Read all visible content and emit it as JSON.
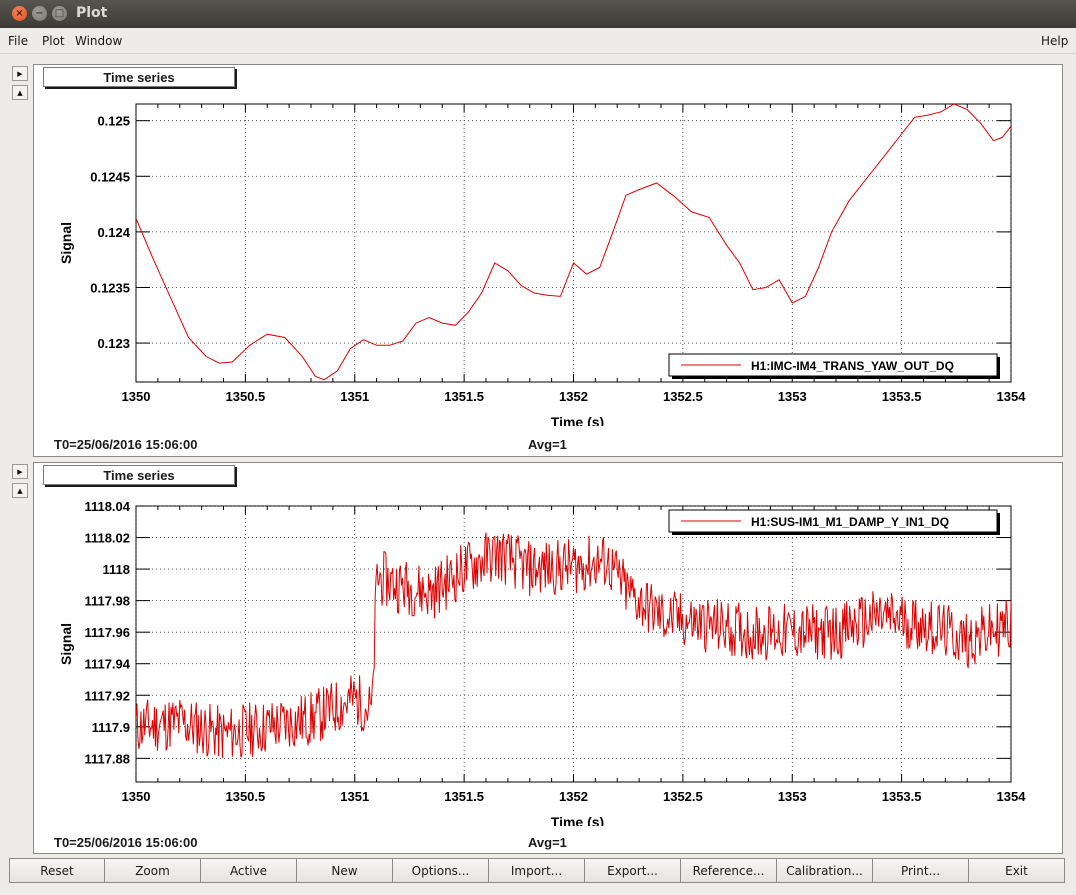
{
  "window": {
    "title": "Plot"
  },
  "menu": {
    "file": "File",
    "plot": "Plot",
    "window": "Window",
    "help": "Help"
  },
  "panels": [
    {
      "tab_label": "Time series",
      "t0": "T0=25/06/2016 15:06:00",
      "avg": "Avg=1",
      "chart_data": {
        "type": "line",
        "xlabel": "Time (s)",
        "ylabel": "Signal",
        "xlim": [
          1350,
          1354
        ],
        "ylim": [
          1.2265,
          1.2515
        ],
        "ylim_scale": 0.1,
        "x_ticks": [
          "1350",
          "1350.5",
          "1351",
          "1351.5",
          "1352",
          "1352.5",
          "1353",
          "1353.5",
          "1354"
        ],
        "y_ticks": [
          {
            "value": 0.123,
            "label": "0.123"
          },
          {
            "value": 0.1235,
            "label": "0.1235"
          },
          {
            "value": 0.124,
            "label": "0.124"
          },
          {
            "value": 0.1245,
            "label": "0.1245"
          },
          {
            "value": 0.125,
            "label": "0.125"
          }
        ],
        "grid": true,
        "legend_position": "bottom-right",
        "series": [
          {
            "name": "H1:IMC-IM4_TRANS_YAW_OUT_DQ",
            "color": "#e00000",
            "x": [
              1350,
              1350.08,
              1350.16,
              1350.24,
              1350.32,
              1350.38,
              1350.44,
              1350.52,
              1350.6,
              1350.68,
              1350.76,
              1350.82,
              1350.86,
              1350.92,
              1350.98,
              1351.04,
              1351.1,
              1351.16,
              1351.22,
              1351.28,
              1351.34,
              1351.4,
              1351.46,
              1351.52,
              1351.58,
              1351.64,
              1351.7,
              1351.76,
              1351.82,
              1351.88,
              1351.94,
              1352,
              1352.06,
              1352.12,
              1352.18,
              1352.24,
              1352.3,
              1352.38,
              1352.46,
              1352.54,
              1352.62,
              1352.7,
              1352.76,
              1352.82,
              1352.88,
              1352.94,
              1353,
              1353.06,
              1353.12,
              1353.18,
              1353.26,
              1353.34,
              1353.42,
              1353.5,
              1353.56,
              1353.62,
              1353.68,
              1353.74,
              1353.8,
              1353.86,
              1353.92,
              1353.96,
              1354
            ],
            "values": [
              0.12412,
              0.12375,
              0.1234,
              0.12305,
              0.12288,
              0.12282,
              0.12283,
              0.12298,
              0.12308,
              0.12305,
              0.12288,
              0.1227,
              0.12267,
              0.12275,
              0.12295,
              0.12303,
              0.12298,
              0.12298,
              0.12302,
              0.12318,
              0.12323,
              0.12318,
              0.12316,
              0.12328,
              0.12345,
              0.12372,
              0.12365,
              0.12352,
              0.12345,
              0.12343,
              0.12342,
              0.12372,
              0.12362,
              0.12368,
              0.124,
              0.12433,
              0.12438,
              0.12444,
              0.12432,
              0.12418,
              0.12413,
              0.12388,
              0.12372,
              0.12348,
              0.1235,
              0.12357,
              0.12336,
              0.12342,
              0.12368,
              0.124,
              0.12428,
              0.12448,
              0.12468,
              0.12488,
              0.12503,
              0.12505,
              0.12508,
              0.12515,
              0.1251,
              0.12498,
              0.12482,
              0.12485,
              0.12495
            ]
          }
        ]
      }
    },
    {
      "tab_label": "Time series",
      "t0": "T0=25/06/2016 15:06:00",
      "avg": "Avg=1",
      "chart_data": {
        "type": "line",
        "xlabel": "Time (s)",
        "ylabel": "Signal",
        "xlim": [
          1350,
          1354
        ],
        "ylim": [
          1117.865,
          1118.04
        ],
        "x_ticks": [
          "1350",
          "1350.5",
          "1351",
          "1351.5",
          "1352",
          "1352.5",
          "1353",
          "1353.5",
          "1354"
        ],
        "y_ticks": [
          {
            "value": 1117.88,
            "label": "1117.88"
          },
          {
            "value": 1117.9,
            "label": "1117.9"
          },
          {
            "value": 1117.92,
            "label": "1117.92"
          },
          {
            "value": 1117.94,
            "label": "1117.94"
          },
          {
            "value": 1117.96,
            "label": "1117.96"
          },
          {
            "value": 1117.98,
            "label": "1117.98"
          },
          {
            "value": 1118,
            "label": "1118"
          },
          {
            "value": 1118.02,
            "label": "1118.02"
          },
          {
            "value": 1118.04,
            "label": "1118.04"
          }
        ],
        "grid": true,
        "legend_position": "top-right",
        "series": [
          {
            "name": "H1:SUS-IM1_M1_DAMP_Y_IN1_DQ",
            "color": "#e00000",
            "x": [
              1350,
              1350.2,
              1350.4,
              1350.6,
              1350.8,
              1351,
              1351.08,
              1351.1,
              1351.2,
              1351.35,
              1351.5,
              1351.65,
              1351.8,
              1352,
              1352.15,
              1352.25,
              1352.4,
              1352.6,
              1352.8,
              1353,
              1353.2,
              1353.4,
              1353.6,
              1353.8,
              1354
            ],
            "values": [
              1117.9,
              1117.903,
              1117.895,
              1117.9,
              1117.905,
              1117.918,
              1117.91,
              1117.995,
              1117.99,
              1117.985,
              1118.0,
              1118.01,
              1118.0,
              1118.002,
              1118.005,
              1117.985,
              1117.97,
              1117.965,
              1117.96,
              1117.96,
              1117.96,
              1117.97,
              1117.965,
              1117.955,
              1117.965
            ]
          }
        ]
      }
    }
  ],
  "toolbar": [
    "Reset",
    "Zoom",
    "Active",
    "New",
    "Options...",
    "Import...",
    "Export...",
    "Reference...",
    "Calibration...",
    "Print...",
    "Exit"
  ]
}
